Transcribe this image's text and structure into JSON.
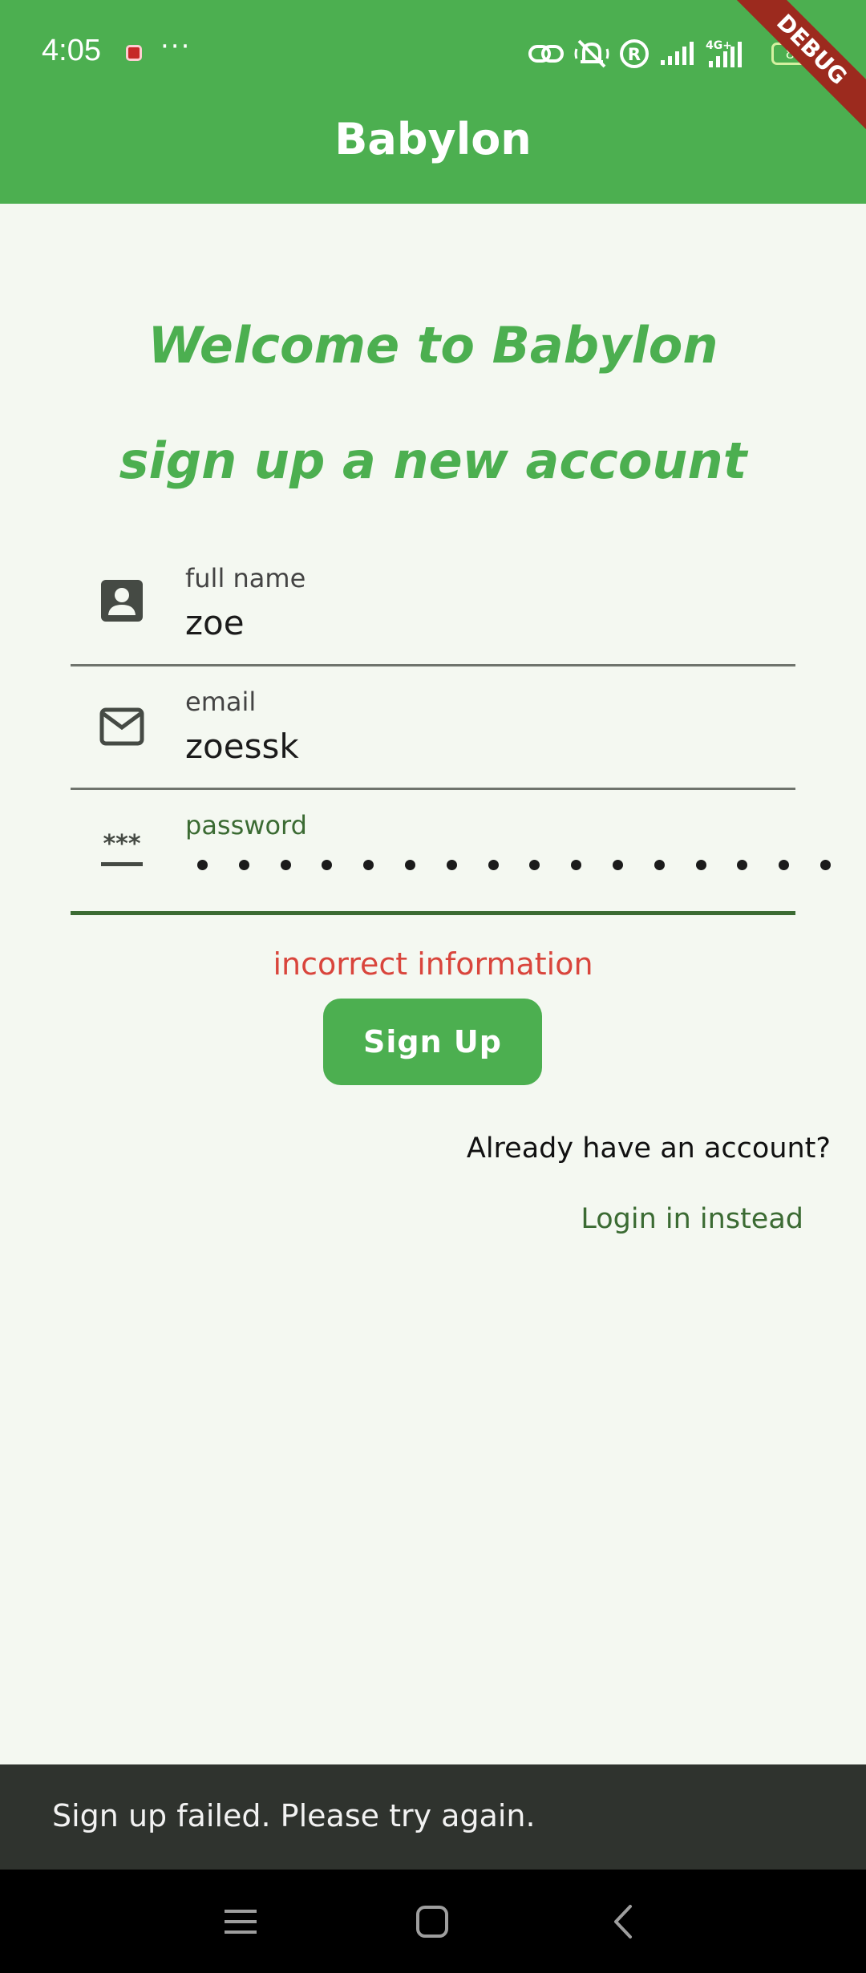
{
  "status_bar": {
    "time": "4:05",
    "more": "···",
    "battery_level": "88",
    "network_type": "4G+"
  },
  "debug_banner": "DEBUG",
  "app_bar": {
    "title": "Babylon"
  },
  "headings": {
    "welcome": "Welcome to Babylon",
    "subtitle": "sign up a new account"
  },
  "form": {
    "full_name": {
      "label": "full name",
      "value": "zoe",
      "icon": "account-box-icon"
    },
    "email": {
      "label": "email",
      "value": "zoessk",
      "icon": "mail-icon"
    },
    "password": {
      "label": "password",
      "masked_length": 16,
      "icon": "password-icon"
    }
  },
  "error_message": "incorrect information",
  "signup_button": "Sign Up",
  "already_account": "Already have an account?",
  "login_link": "Login in instead",
  "snackbar": "Sign up failed. Please try again.",
  "colors": {
    "primary": "#4caf50",
    "background": "#f4f8f1",
    "error": "#d9453c",
    "link": "#3b6b33",
    "snackbar": "#2f332e"
  }
}
